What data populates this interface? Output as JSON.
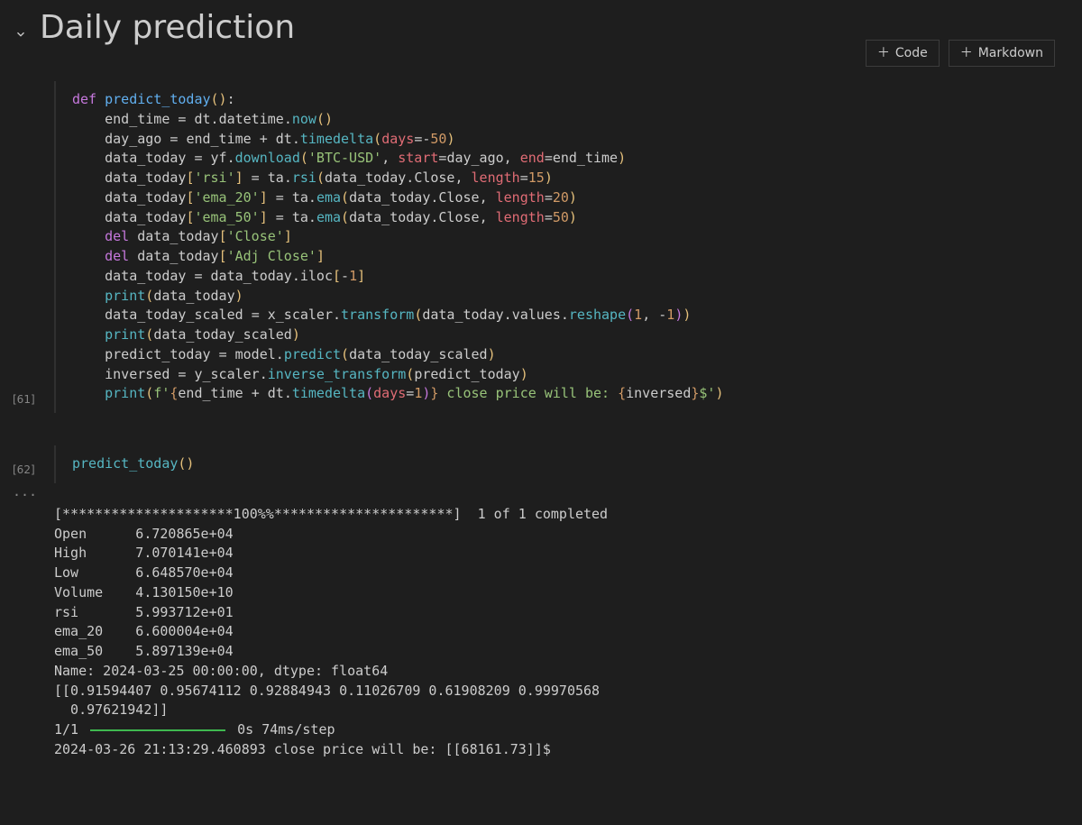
{
  "title": "Daily prediction",
  "toolbar": {
    "code_label": "Code",
    "markdown_label": "Markdown"
  },
  "cells": [
    {
      "execution_count": "[61]",
      "lines": [
        [
          {
            "c": "kw",
            "t": "def "
          },
          {
            "c": "fn",
            "t": "predict_today"
          },
          {
            "c": "paren",
            "t": "()"
          },
          {
            "c": "id",
            "t": ":"
          }
        ],
        [
          {
            "c": "id",
            "t": "    end_time "
          },
          {
            "c": "op",
            "t": "= "
          },
          {
            "c": "id",
            "t": "dt"
          },
          {
            "c": "op",
            "t": "."
          },
          {
            "c": "id",
            "t": "datetime"
          },
          {
            "c": "op",
            "t": "."
          },
          {
            "c": "call",
            "t": "now"
          },
          {
            "c": "paren",
            "t": "()"
          }
        ],
        [
          {
            "c": "id",
            "t": "    day_ago "
          },
          {
            "c": "op",
            "t": "= "
          },
          {
            "c": "id",
            "t": "end_time "
          },
          {
            "c": "op",
            "t": "+ "
          },
          {
            "c": "id",
            "t": "dt"
          },
          {
            "c": "op",
            "t": "."
          },
          {
            "c": "call",
            "t": "timedelta"
          },
          {
            "c": "paren",
            "t": "("
          },
          {
            "c": "param",
            "t": "days"
          },
          {
            "c": "op",
            "t": "="
          },
          {
            "c": "op",
            "t": "-"
          },
          {
            "c": "num",
            "t": "50"
          },
          {
            "c": "paren",
            "t": ")"
          }
        ],
        [
          {
            "c": "id",
            "t": "    data_today "
          },
          {
            "c": "op",
            "t": "= "
          },
          {
            "c": "id",
            "t": "yf"
          },
          {
            "c": "op",
            "t": "."
          },
          {
            "c": "call",
            "t": "download"
          },
          {
            "c": "paren",
            "t": "("
          },
          {
            "c": "str",
            "t": "'BTC-USD'"
          },
          {
            "c": "op",
            "t": ", "
          },
          {
            "c": "param",
            "t": "start"
          },
          {
            "c": "op",
            "t": "="
          },
          {
            "c": "id",
            "t": "day_ago"
          },
          {
            "c": "op",
            "t": ", "
          },
          {
            "c": "param",
            "t": "end"
          },
          {
            "c": "op",
            "t": "="
          },
          {
            "c": "id",
            "t": "end_time"
          },
          {
            "c": "paren",
            "t": ")"
          }
        ],
        [
          {
            "c": "id",
            "t": "    data_today"
          },
          {
            "c": "paren",
            "t": "["
          },
          {
            "c": "str",
            "t": "'rsi'"
          },
          {
            "c": "paren",
            "t": "]"
          },
          {
            "c": "op",
            "t": " = "
          },
          {
            "c": "id",
            "t": "ta"
          },
          {
            "c": "op",
            "t": "."
          },
          {
            "c": "call",
            "t": "rsi"
          },
          {
            "c": "paren",
            "t": "("
          },
          {
            "c": "id",
            "t": "data_today"
          },
          {
            "c": "op",
            "t": "."
          },
          {
            "c": "id",
            "t": "Close"
          },
          {
            "c": "op",
            "t": ", "
          },
          {
            "c": "param",
            "t": "length"
          },
          {
            "c": "op",
            "t": "="
          },
          {
            "c": "num",
            "t": "15"
          },
          {
            "c": "paren",
            "t": ")"
          }
        ],
        [
          {
            "c": "id",
            "t": "    data_today"
          },
          {
            "c": "paren",
            "t": "["
          },
          {
            "c": "str",
            "t": "'ema_20'"
          },
          {
            "c": "paren",
            "t": "]"
          },
          {
            "c": "op",
            "t": " = "
          },
          {
            "c": "id",
            "t": "ta"
          },
          {
            "c": "op",
            "t": "."
          },
          {
            "c": "call",
            "t": "ema"
          },
          {
            "c": "paren",
            "t": "("
          },
          {
            "c": "id",
            "t": "data_today"
          },
          {
            "c": "op",
            "t": "."
          },
          {
            "c": "id",
            "t": "Close"
          },
          {
            "c": "op",
            "t": ", "
          },
          {
            "c": "param",
            "t": "length"
          },
          {
            "c": "op",
            "t": "="
          },
          {
            "c": "num",
            "t": "20"
          },
          {
            "c": "paren",
            "t": ")"
          }
        ],
        [
          {
            "c": "id",
            "t": "    data_today"
          },
          {
            "c": "paren",
            "t": "["
          },
          {
            "c": "str",
            "t": "'ema_50'"
          },
          {
            "c": "paren",
            "t": "]"
          },
          {
            "c": "op",
            "t": " = "
          },
          {
            "c": "id",
            "t": "ta"
          },
          {
            "c": "op",
            "t": "."
          },
          {
            "c": "call",
            "t": "ema"
          },
          {
            "c": "paren",
            "t": "("
          },
          {
            "c": "id",
            "t": "data_today"
          },
          {
            "c": "op",
            "t": "."
          },
          {
            "c": "id",
            "t": "Close"
          },
          {
            "c": "op",
            "t": ", "
          },
          {
            "c": "param",
            "t": "length"
          },
          {
            "c": "op",
            "t": "="
          },
          {
            "c": "num",
            "t": "50"
          },
          {
            "c": "paren",
            "t": ")"
          }
        ],
        [
          {
            "c": "kw",
            "t": "    del "
          },
          {
            "c": "id",
            "t": "data_today"
          },
          {
            "c": "paren",
            "t": "["
          },
          {
            "c": "str",
            "t": "'Close'"
          },
          {
            "c": "paren",
            "t": "]"
          }
        ],
        [
          {
            "c": "kw",
            "t": "    del "
          },
          {
            "c": "id",
            "t": "data_today"
          },
          {
            "c": "paren",
            "t": "["
          },
          {
            "c": "str",
            "t": "'Adj Close'"
          },
          {
            "c": "paren",
            "t": "]"
          }
        ],
        [
          {
            "c": "id",
            "t": "    data_today "
          },
          {
            "c": "op",
            "t": "= "
          },
          {
            "c": "id",
            "t": "data_today"
          },
          {
            "c": "op",
            "t": "."
          },
          {
            "c": "id",
            "t": "iloc"
          },
          {
            "c": "paren",
            "t": "["
          },
          {
            "c": "op",
            "t": "-"
          },
          {
            "c": "num",
            "t": "1"
          },
          {
            "c": "paren",
            "t": "]"
          }
        ],
        [
          {
            "c": "call",
            "t": "    print"
          },
          {
            "c": "paren",
            "t": "("
          },
          {
            "c": "id",
            "t": "data_today"
          },
          {
            "c": "paren",
            "t": ")"
          }
        ],
        [
          {
            "c": "id",
            "t": "    data_today_scaled "
          },
          {
            "c": "op",
            "t": "= "
          },
          {
            "c": "id",
            "t": "x_scaler"
          },
          {
            "c": "op",
            "t": "."
          },
          {
            "c": "call",
            "t": "transform"
          },
          {
            "c": "paren",
            "t": "("
          },
          {
            "c": "id",
            "t": "data_today"
          },
          {
            "c": "op",
            "t": "."
          },
          {
            "c": "id",
            "t": "values"
          },
          {
            "c": "op",
            "t": "."
          },
          {
            "c": "call",
            "t": "reshape"
          },
          {
            "c": "paren2",
            "t": "("
          },
          {
            "c": "num",
            "t": "1"
          },
          {
            "c": "op",
            "t": ", "
          },
          {
            "c": "op",
            "t": "-"
          },
          {
            "c": "num",
            "t": "1"
          },
          {
            "c": "paren2",
            "t": ")"
          },
          {
            "c": "paren",
            "t": ")"
          }
        ],
        [
          {
            "c": "call",
            "t": "    print"
          },
          {
            "c": "paren",
            "t": "("
          },
          {
            "c": "id",
            "t": "data_today_scaled"
          },
          {
            "c": "paren",
            "t": ")"
          }
        ],
        [
          {
            "c": "id",
            "t": "    predict_today "
          },
          {
            "c": "op",
            "t": "= "
          },
          {
            "c": "id",
            "t": "model"
          },
          {
            "c": "op",
            "t": "."
          },
          {
            "c": "call",
            "t": "predict"
          },
          {
            "c": "paren",
            "t": "("
          },
          {
            "c": "id",
            "t": "data_today_scaled"
          },
          {
            "c": "paren",
            "t": ")"
          }
        ],
        [
          {
            "c": "id",
            "t": "    inversed "
          },
          {
            "c": "op",
            "t": "= "
          },
          {
            "c": "id",
            "t": "y_scaler"
          },
          {
            "c": "op",
            "t": "."
          },
          {
            "c": "call",
            "t": "inverse_transform"
          },
          {
            "c": "paren",
            "t": "("
          },
          {
            "c": "id",
            "t": "predict_today"
          },
          {
            "c": "paren",
            "t": ")"
          }
        ],
        [
          {
            "c": "call",
            "t": "    print"
          },
          {
            "c": "paren",
            "t": "("
          },
          {
            "c": "str",
            "t": "f'"
          },
          {
            "c": "fstr",
            "t": "{"
          },
          {
            "c": "id",
            "t": "end_time "
          },
          {
            "c": "op",
            "t": "+ "
          },
          {
            "c": "id",
            "t": "dt"
          },
          {
            "c": "op",
            "t": "."
          },
          {
            "c": "call",
            "t": "timedelta"
          },
          {
            "c": "paren2",
            "t": "("
          },
          {
            "c": "param",
            "t": "days"
          },
          {
            "c": "op",
            "t": "="
          },
          {
            "c": "num",
            "t": "1"
          },
          {
            "c": "paren2",
            "t": ")"
          },
          {
            "c": "fstr",
            "t": "}"
          },
          {
            "c": "str",
            "t": " close price will be: "
          },
          {
            "c": "fstr",
            "t": "{"
          },
          {
            "c": "id",
            "t": "inversed"
          },
          {
            "c": "fstr",
            "t": "}"
          },
          {
            "c": "str",
            "t": "$'"
          },
          {
            "c": "paren",
            "t": ")"
          }
        ]
      ]
    },
    {
      "execution_count": "[62]",
      "lines": [
        [
          {
            "c": "call",
            "t": "predict_today"
          },
          {
            "c": "paren",
            "t": "()"
          }
        ]
      ]
    }
  ],
  "output": {
    "dots": "...",
    "lines_before": [
      "[*********************100%%**********************]  1 of 1 completed",
      "Open      6.720865e+04",
      "High      7.070141e+04",
      "Low       6.648570e+04",
      "Volume    4.130150e+10",
      "rsi       5.993712e+01",
      "ema_20    6.600004e+04",
      "ema_50    5.897139e+04",
      "Name: 2024-03-25 00:00:00, dtype: float64",
      "[[0.91594407 0.95674112 0.92884943 0.11026709 0.61908209 0.99970568",
      "  0.97621942]]"
    ],
    "progress_prefix": "1/1 ",
    "progress_suffix": " 0s 74ms/step",
    "final_line": "2024-03-26 21:13:29.460893 close price will be: [[68161.73]]$"
  }
}
